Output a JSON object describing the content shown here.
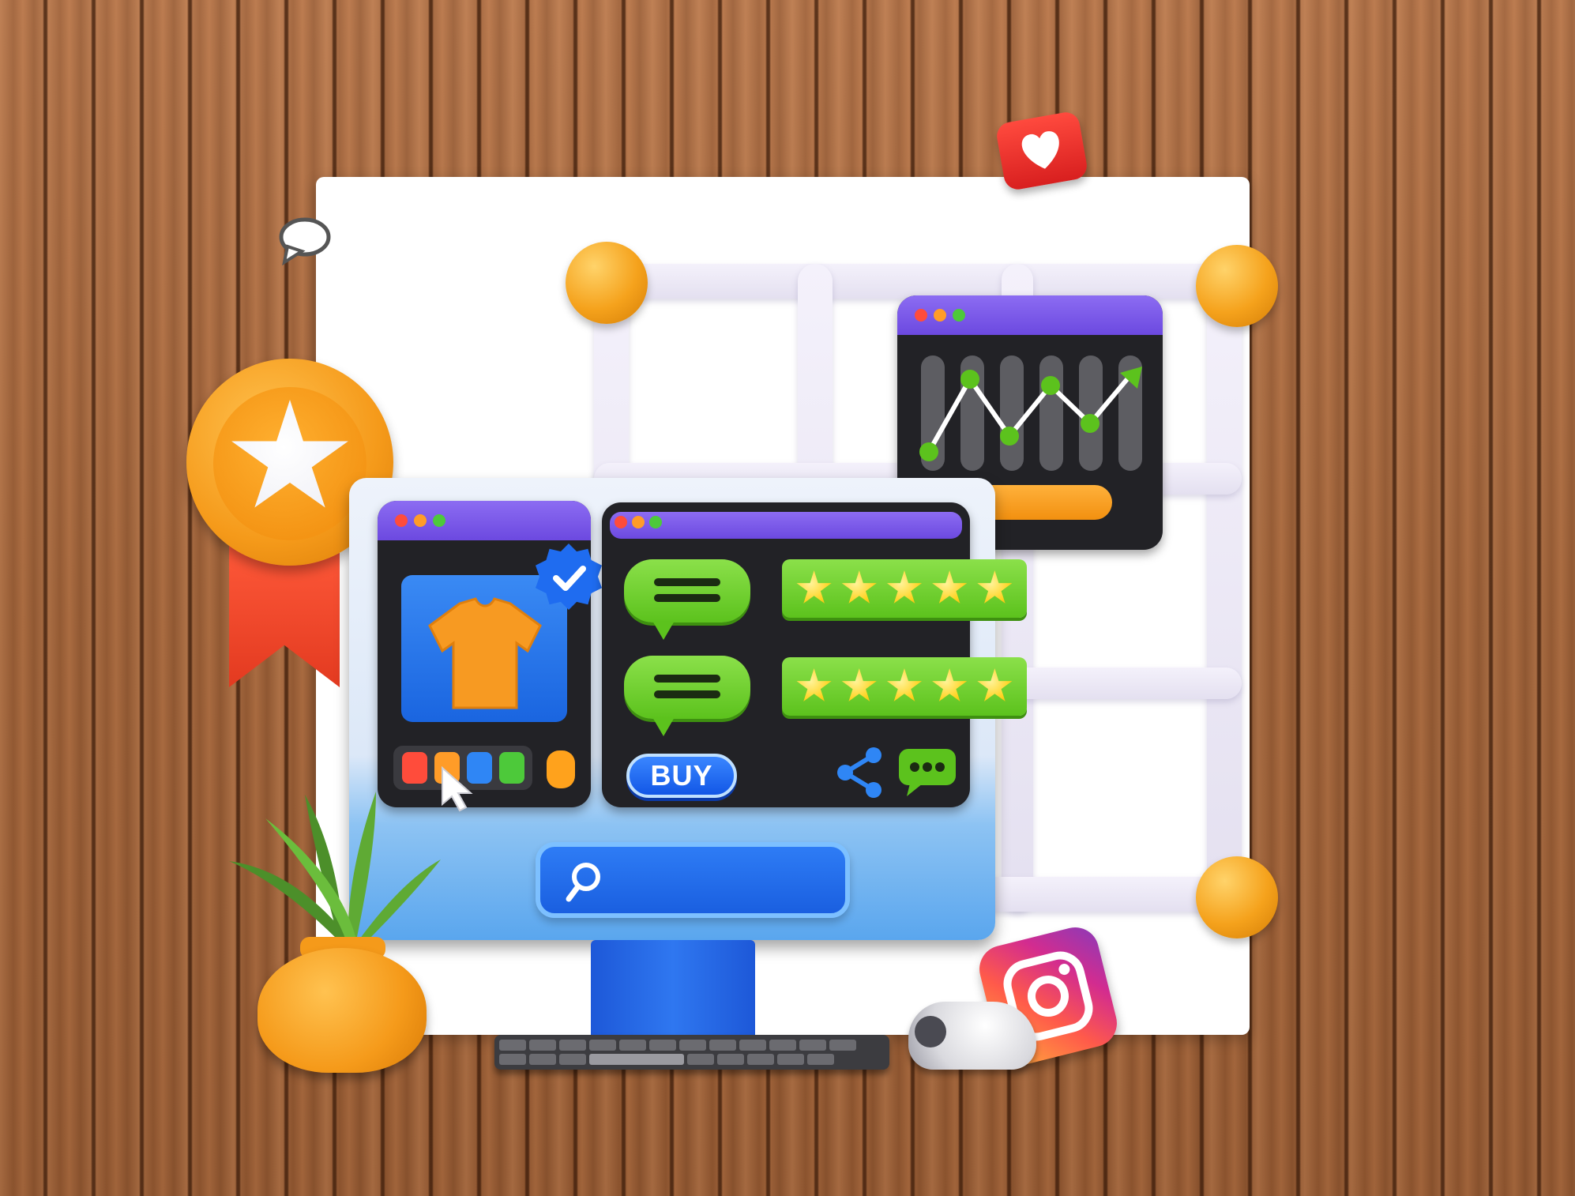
{
  "scene": {
    "buy_label": "BUY"
  },
  "colors": {
    "window_bar": "#7a59ea",
    "bubble_green": "#6fd22c",
    "star_yellow": "#ffd21e",
    "accent_orange": "#f5a21c",
    "button_blue": "#1f6cf0",
    "heart_red": "#e8322e"
  },
  "icons": [
    "chat-bubble-icon",
    "heart-like-icon",
    "award-badge-icon",
    "verified-check-icon",
    "share-icon",
    "comment-icon",
    "search-icon",
    "cursor-icon",
    "instagram-icon",
    "plant-pot",
    "computer-mouse"
  ],
  "product": {
    "swatches": [
      "#ff4c3b",
      "#ff9c28",
      "#2f86f5",
      "#4dc93a"
    ]
  },
  "reviews": [
    {
      "stars": 5
    },
    {
      "stars": 5
    }
  ]
}
